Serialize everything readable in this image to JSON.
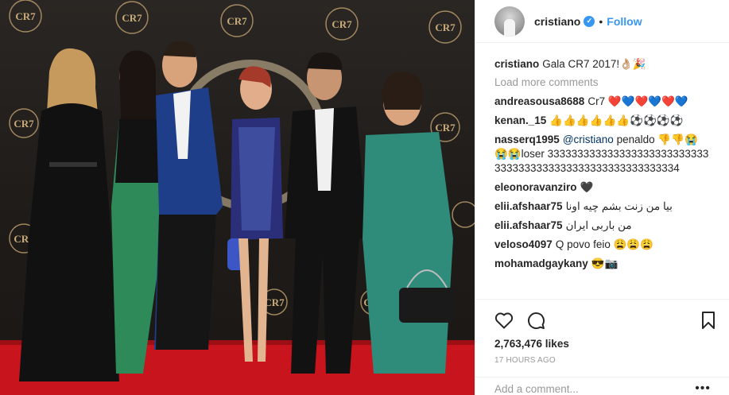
{
  "photo": {
    "logo_text": "CR7",
    "description_icon": "event-photo"
  },
  "header": {
    "username": "cristiano",
    "verified_icon": "verified-badge-icon",
    "separator": "•",
    "follow_label": "Follow"
  },
  "caption": {
    "user": "cristiano",
    "text": "Gala CR7 2017!👌🏼🎉"
  },
  "load_more_label": "Load more comments",
  "comments": [
    {
      "user": "andreasousa8688",
      "text": "Cr7 ❤️💙❤️💙❤️💙"
    },
    {
      "user": "kenan._15",
      "text": "👍👍👍👍👍👍⚽️⚽️⚽️⚽️"
    },
    {
      "user": "nasserq1995",
      "mention": "@cristiano",
      "text": "penaldo 👎👎😭😭😭loser 3333333333333333333333333333333333333333333333333333333334"
    },
    {
      "user": "eleonoravanziro",
      "text": "🖤"
    },
    {
      "user": "elii.afshaar75",
      "text": "بیا من زنت بشم چیه اونا"
    },
    {
      "user": "elii.afshaar75",
      "text": "من باربی ایران"
    },
    {
      "user": "veloso4097",
      "text": "Q povo feio 😩😩😩"
    },
    {
      "user": "mohamadgaykany",
      "text": "😎📷"
    }
  ],
  "actions": {
    "like_icon": "heart-icon",
    "comment_icon": "comment-icon",
    "save_icon": "bookmark-icon",
    "likes_text": "2,763,476 likes",
    "time_text": "17 HOURS AGO"
  },
  "add_comment": {
    "placeholder": "Add a comment...",
    "more_label": "•••"
  },
  "colors": {
    "accent": "#3897f0",
    "text": "#262626",
    "muted": "#999999",
    "border": "#efefef",
    "carpet": "#c8141c"
  }
}
